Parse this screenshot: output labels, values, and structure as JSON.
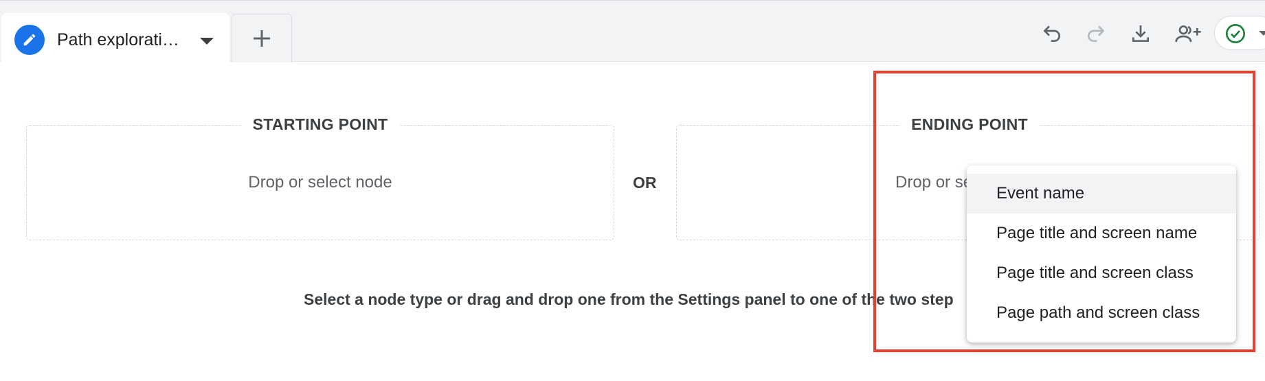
{
  "tab": {
    "title": "Path explorati…",
    "icon": "pencil-icon"
  },
  "toolbar": {
    "icons": [
      "undo-icon",
      "redo-icon",
      "download-icon",
      "share-users-icon",
      "check-circle-icon"
    ],
    "accent": "#1a73e8",
    "status_color": "#188038"
  },
  "starting_point": {
    "label": "STARTING POINT",
    "placeholder": "Drop or select node"
  },
  "or_label": "OR",
  "ending_point": {
    "label": "ENDING POINT",
    "placeholder": "Drop or se"
  },
  "instruction": "Select a node type or drag and drop one from the Settings panel to one of the two step",
  "node_menu": {
    "items": [
      {
        "label": "Event name",
        "active": true
      },
      {
        "label": "Page title and screen name",
        "active": false
      },
      {
        "label": "Page title and screen class",
        "active": false
      },
      {
        "label": "Page path and screen class",
        "active": false
      }
    ]
  },
  "highlight_color": "#e8402c"
}
